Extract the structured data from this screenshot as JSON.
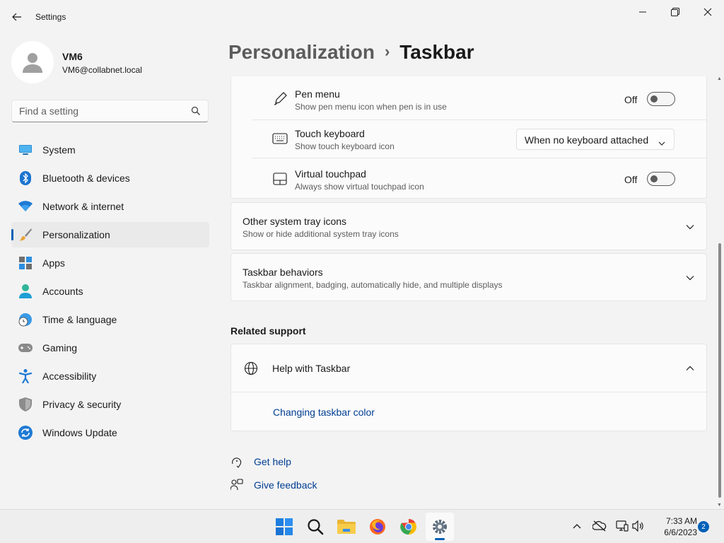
{
  "window": {
    "app_title": "Settings",
    "controls": [
      "minimize",
      "restore",
      "close"
    ]
  },
  "profile": {
    "name": "VM6",
    "email": "VM6@collabnet.local"
  },
  "search": {
    "placeholder": "Find a setting",
    "icon": "search-icon"
  },
  "sidebar": {
    "items": [
      {
        "label": "System",
        "icon": "system-icon",
        "active": false
      },
      {
        "label": "Bluetooth & devices",
        "icon": "bluetooth-icon",
        "active": false
      },
      {
        "label": "Network & internet",
        "icon": "wifi-icon",
        "active": false
      },
      {
        "label": "Personalization",
        "icon": "brush-icon",
        "active": true
      },
      {
        "label": "Apps",
        "icon": "apps-icon",
        "active": false
      },
      {
        "label": "Accounts",
        "icon": "accounts-icon",
        "active": false
      },
      {
        "label": "Time & language",
        "icon": "clock-globe-icon",
        "active": false
      },
      {
        "label": "Gaming",
        "icon": "gamepad-icon",
        "active": false
      },
      {
        "label": "Accessibility",
        "icon": "accessibility-icon",
        "active": false
      },
      {
        "label": "Privacy & security",
        "icon": "shield-icon",
        "active": false
      },
      {
        "label": "Windows Update",
        "icon": "update-icon",
        "active": false
      }
    ]
  },
  "breadcrumb": {
    "parent": "Personalization",
    "separator": "›",
    "current": "Taskbar"
  },
  "corner_icons": {
    "rows": [
      {
        "title": "Pen menu",
        "subtitle": "Show pen menu icon when pen is in use",
        "icon": "pen-icon",
        "control": "toggle",
        "state_label": "Off",
        "on": false
      },
      {
        "title": "Touch keyboard",
        "subtitle": "Show touch keyboard icon",
        "icon": "keyboard-icon",
        "control": "dropdown",
        "value": "When no keyboard attached"
      },
      {
        "title": "Virtual touchpad",
        "subtitle": "Always show virtual touchpad icon",
        "icon": "touchpad-icon",
        "control": "toggle",
        "state_label": "Off",
        "on": false
      }
    ]
  },
  "expanders": [
    {
      "title": "Other system tray icons",
      "subtitle": "Show or hide additional system tray icons",
      "expanded": false
    },
    {
      "title": "Taskbar behaviors",
      "subtitle": "Taskbar alignment, badging, automatically hide, and multiple displays",
      "expanded": false
    }
  ],
  "related_support": {
    "heading": "Related support",
    "help": {
      "title": "Help with Taskbar",
      "icon": "globe-icon",
      "expanded": true,
      "link": "Changing taskbar color"
    }
  },
  "footer_links": [
    {
      "label": "Get help",
      "icon": "get-help-icon"
    },
    {
      "label": "Give feedback",
      "icon": "feedback-icon"
    }
  ],
  "taskbar": {
    "apps": [
      {
        "name": "start-icon",
        "active": false
      },
      {
        "name": "search-icon",
        "active": false
      },
      {
        "name": "file-explorer-icon",
        "active": false
      },
      {
        "name": "firefox-icon",
        "active": false
      },
      {
        "name": "chrome-icon",
        "active": false
      },
      {
        "name": "settings-icon",
        "active": true
      }
    ],
    "tray": [
      "chevron-up-icon",
      "onedrive-offline-icon",
      "network-icon",
      "volume-icon"
    ],
    "time": "7:33 AM",
    "date": "6/6/2023",
    "notification_count": "2"
  },
  "colors": {
    "accent": "#005fb8",
    "link": "#003e92",
    "window_bg": "#f3f3f3",
    "card_bg": "#fbfbfb"
  }
}
